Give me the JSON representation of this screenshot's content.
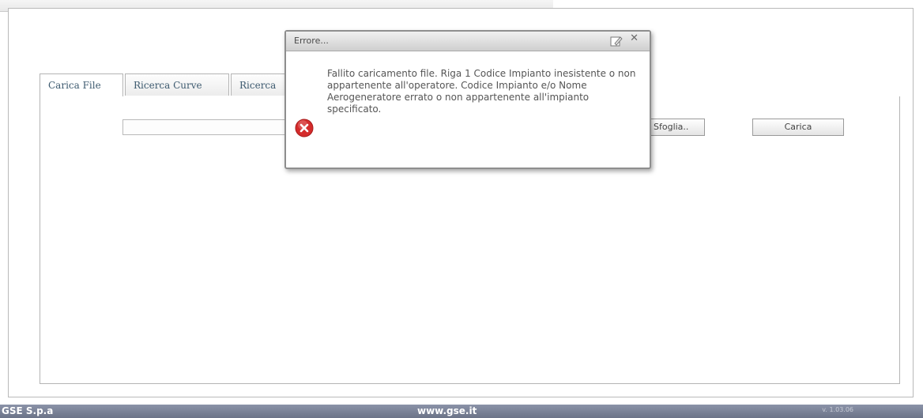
{
  "tabs": [
    {
      "label": "Carica File",
      "active": true
    },
    {
      "label": "Ricerca Curve",
      "active": false
    },
    {
      "label": "Ricerca",
      "active": false
    }
  ],
  "upload": {
    "file_value": "",
    "browse_label": "Sfoglia..",
    "load_label": "Carica"
  },
  "dialog": {
    "title": "Errore...",
    "icon": "error-icon",
    "message": "Fallito caricamento file. Riga 1 Codice Impianto inesistente o non appartenente all'operatore. Codice Impianto e/o Nome Aerogeneratore errato o non appartenente all'impianto specificato."
  },
  "footer": {
    "company": "GSE S.p.a",
    "website": "www.gse.it",
    "version": "v. 1.03.06"
  },
  "colors": {
    "footer_bg": "#7b8398",
    "tab_text": "#3d5a6f",
    "error_red": "#d42b2b"
  }
}
